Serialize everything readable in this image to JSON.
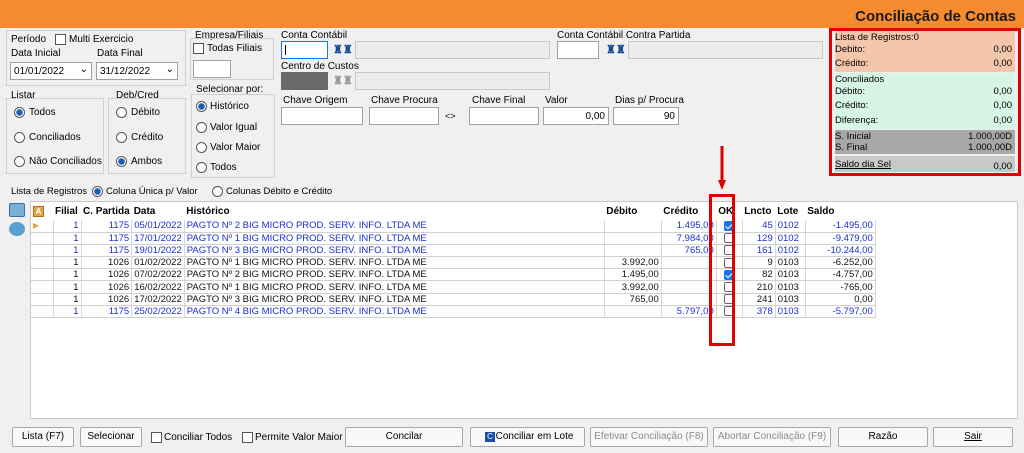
{
  "window": {
    "title": "Conciliação de Contas"
  },
  "periodo": {
    "label": "Período",
    "multi_label": "Multi Exercicio",
    "data_inicial_label": "Data Inicial",
    "data_final_label": "Data Final",
    "data_inicial": "01/01/2022",
    "data_final": "31/12/2022"
  },
  "empresa": {
    "label": "Empresa/Filiais",
    "todas_label": "Todas Filiais"
  },
  "conta": {
    "label": "Conta Contábil",
    "centro_label": "Centro de Custos",
    "contra_label": "Conta Contábil Contra Partida"
  },
  "listar": {
    "label": "Listar",
    "options": [
      "Todos",
      "Conciliados",
      "Não Conciliados"
    ],
    "selected": "Todos"
  },
  "debcred": {
    "label": "Deb/Cred",
    "options": [
      "Débito",
      "Crédito",
      "Ambos"
    ],
    "selected": "Ambos"
  },
  "selecionar": {
    "label": "Selecionar por:",
    "options": [
      "Histórico",
      "Valor Igual",
      "Valor Maior",
      "Todos"
    ],
    "selected": "Histórico"
  },
  "filters": {
    "chave_origem_label": "Chave Origem",
    "chave_procura_label": "Chave Procura",
    "chave_final_label": "Chave Final",
    "valor_label": "Valor",
    "valor": "0,00",
    "dias_label": "Dias p/ Procura",
    "dias": "90",
    "swap_label": "<>"
  },
  "summary": {
    "lista_label": "Lista de Registros:0",
    "debito_label": "Debito:",
    "debito": "0,00",
    "credito_label": "Crédito:",
    "credito": "0,00",
    "conciliados_label": "Conciliados",
    "c_debito_label": "Débito:",
    "c_debito": "0,00",
    "c_credito_label": "Crédito:",
    "c_credito": "0,00",
    "diferenca_label": "Diferença:",
    "diferenca": "0,00",
    "s_inicial_label": "S. Inicial",
    "s_inicial": "1.000,00D",
    "s_final_label": "S. Final",
    "s_final": "1.000,00D",
    "saldo_label": "Saldo dia Sel",
    "saldo": "0,00"
  },
  "lista": {
    "label": "Lista de Registros",
    "opt1": "Coluna Única p/ Valor",
    "opt2": "Colunas Débito e Crédito"
  },
  "table": {
    "headers": [
      "Filial",
      "C. Partida",
      "Data",
      "Histórico",
      "Débito",
      "Crédito",
      "OK",
      "Lncto",
      "Lote",
      "Saldo"
    ],
    "rows": [
      {
        "filial": "1",
        "cp": "1175",
        "data": "05/01/2022",
        "hist": "PAGTO Nº 2 BIG MICRO PROD. SERV. INFO. LTDA ME",
        "debito": "",
        "credito": "1.495,00",
        "ok": true,
        "lncto": "45",
        "lote": "0102",
        "saldo": "-1.495,00",
        "color": "blue"
      },
      {
        "filial": "1",
        "cp": "1175",
        "data": "17/01/2022",
        "hist": "PAGTO Nº 1 BIG MICRO PROD. SERV. INFO. LTDA ME",
        "debito": "",
        "credito": "7.984,00",
        "ok": false,
        "lncto": "129",
        "lote": "0102",
        "saldo": "-9.479,00",
        "color": "blue"
      },
      {
        "filial": "1",
        "cp": "1175",
        "data": "19/01/2022",
        "hist": "PAGTO Nº 3 BIG MICRO PROD. SERV. INFO. LTDA ME",
        "debito": "",
        "credito": "765,00",
        "ok": false,
        "lncto": "161",
        "lote": "0102",
        "saldo": "-10.244,00",
        "color": "blue"
      },
      {
        "filial": "1",
        "cp": "1026",
        "data": "01/02/2022",
        "hist": "PAGTO Nº 1 BIG MICRO PROD. SERV. INFO. LTDA ME",
        "debito": "3.992,00",
        "credito": "",
        "ok": false,
        "lncto": "9",
        "lote": "0103",
        "saldo": "-6.252,00",
        "color": "blk"
      },
      {
        "filial": "1",
        "cp": "1026",
        "data": "07/02/2022",
        "hist": "PAGTO Nº 2 BIG MICRO PROD. SERV. INFO. LTDA ME",
        "debito": "1.495,00",
        "credito": "",
        "ok": true,
        "lncto": "82",
        "lote": "0103",
        "saldo": "-4.757,00",
        "color": "blk"
      },
      {
        "filial": "1",
        "cp": "1026",
        "data": "16/02/2022",
        "hist": "PAGTO Nº 1 BIG MICRO PROD. SERV. INFO. LTDA ME",
        "debito": "3.992,00",
        "credito": "",
        "ok": false,
        "lncto": "210",
        "lote": "0103",
        "saldo": "-765,00",
        "color": "blk"
      },
      {
        "filial": "1",
        "cp": "1026",
        "data": "17/02/2022",
        "hist": "PAGTO Nº 3 BIG MICRO PROD. SERV. INFO. LTDA ME",
        "debito": "765,00",
        "credito": "",
        "ok": false,
        "lncto": "241",
        "lote": "0103",
        "saldo": "0,00",
        "color": "blk"
      },
      {
        "filial": "1",
        "cp": "1175",
        "data": "25/02/2022",
        "hist": "PAGTO Nº 4 BIG MICRO PROD. SERV. INFO. LTDA ME",
        "debito": "",
        "credito": "5.797,00",
        "ok": false,
        "lncto": "378",
        "lote": "0103",
        "saldo": "-5.797,00",
        "color": "blue"
      }
    ]
  },
  "footer": {
    "lista": "Lista (F7)",
    "selecionar": "Selecionar",
    "conciliar_todos": "Conciliar Todos",
    "permite": "Permite Valor Maior",
    "concilar": "Concilar",
    "conciliar_lote": "Conciliar  em Lote",
    "efetivar": "Efetivar Conciliação (F8)",
    "abortar": "Abortar Conciliação (F9)",
    "razao": "Razão",
    "sair": "Sair"
  },
  "colors": {
    "title_bar": "#f58a2e",
    "highlight": "#e00000",
    "summary_top": "#f4c7ad",
    "summary_mid": "#d6f5e6",
    "summary_bot": "#a8a8a8"
  }
}
